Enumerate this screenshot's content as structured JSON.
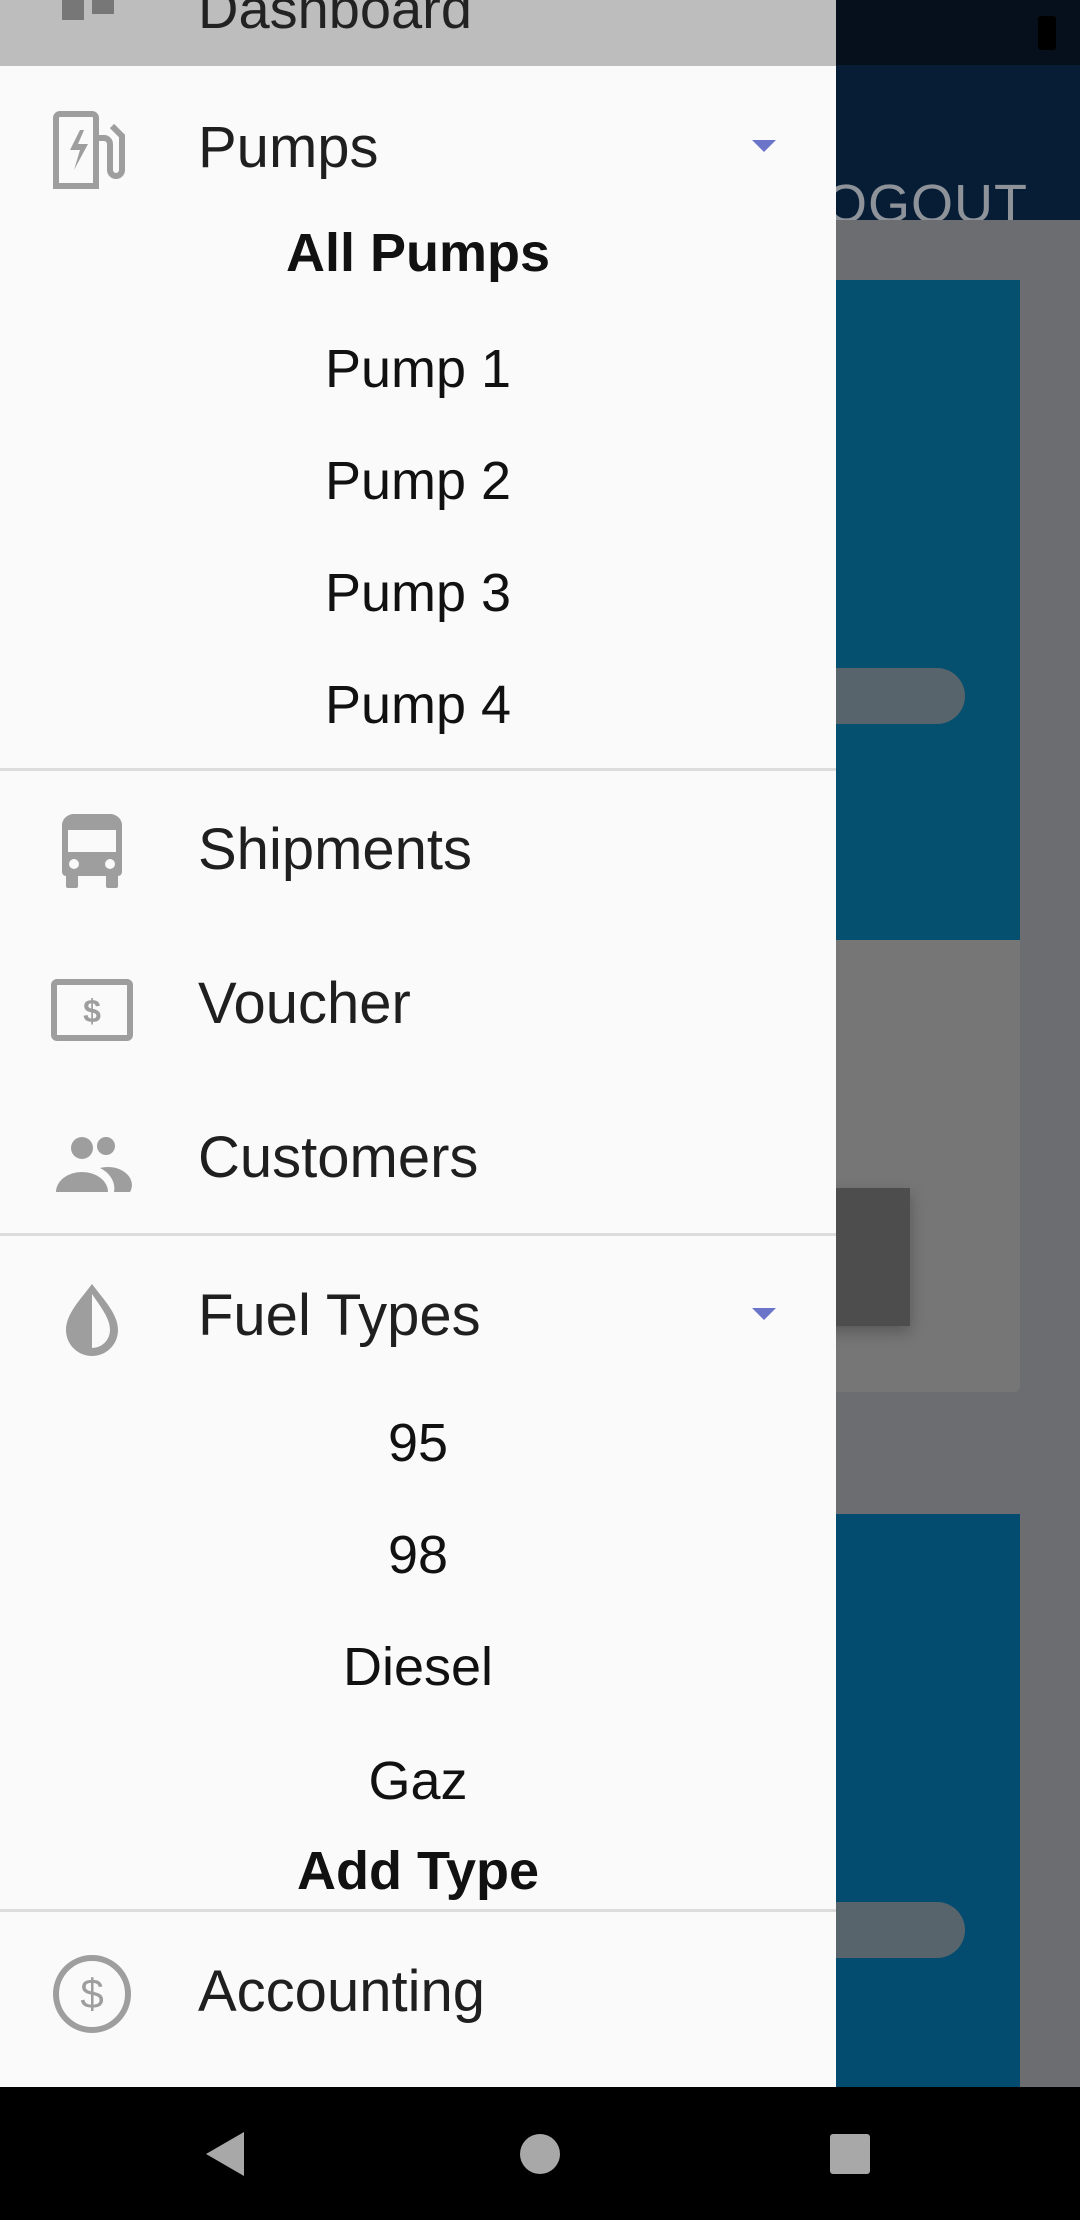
{
  "app": {
    "logout_label": "OGOUT"
  },
  "drawer": {
    "dashboard_label": "Dashboard",
    "pumps": {
      "label": "Pumps",
      "icon": "fuel-pump-icon",
      "items": [
        "All Pumps",
        "Pump 1",
        "Pump 2",
        "Pump 3",
        "Pump 4"
      ]
    },
    "shipments": {
      "label": "Shipments",
      "icon": "bus-icon"
    },
    "voucher": {
      "label": "Voucher",
      "icon": "dollar-bill-icon"
    },
    "customers": {
      "label": "Customers",
      "icon": "people-icon"
    },
    "fuel_types": {
      "label": "Fuel Types",
      "icon": "water-drop-icon",
      "items": [
        "95",
        "98",
        "Diesel",
        "Gaz"
      ],
      "add_label": "Add Type"
    },
    "accounting": {
      "label": "Accounting",
      "icon": "dollar-circle-icon"
    }
  },
  "colors": {
    "drawer_bg": "#fafafa",
    "selected_row": "#bdbdbd",
    "icon_gray": "#9e9e9e",
    "caret_accent": "#6b74c9",
    "appbar": "#061d35",
    "card_blue": "#05506f"
  }
}
